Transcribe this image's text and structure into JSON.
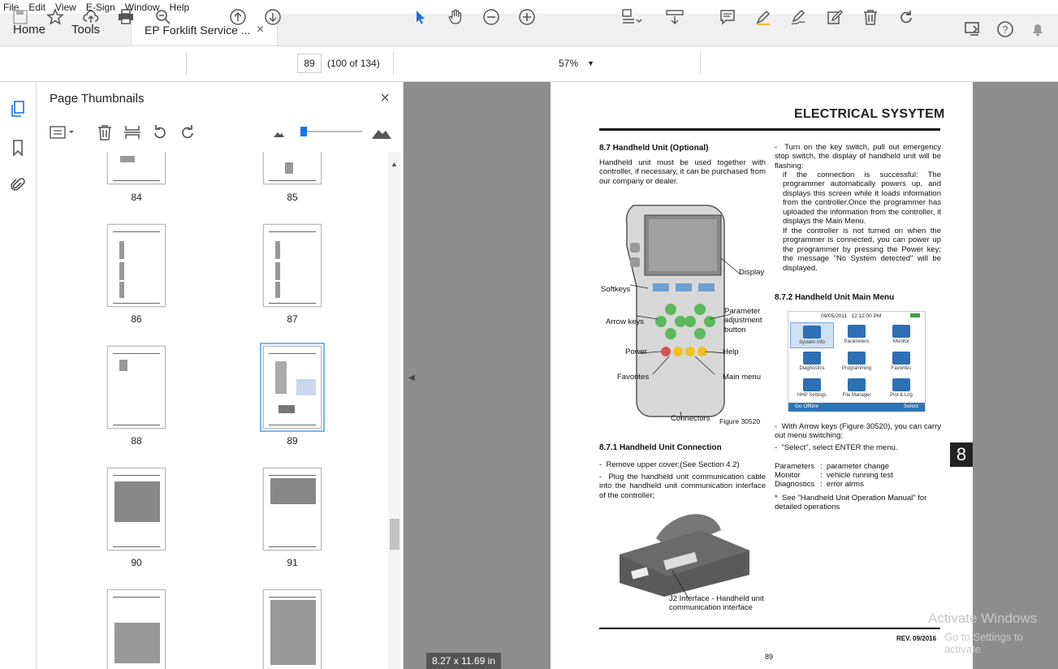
{
  "menu": [
    "File",
    "Edit",
    "View",
    "E-Sign",
    "Window",
    "Help"
  ],
  "tabs": {
    "home": "Home",
    "tools": "Tools",
    "document": "EP Forklift Service ...",
    "close": "×"
  },
  "toolbar": {
    "page_number": "89",
    "page_count": "(100 of 134)",
    "zoom": "57%"
  },
  "panel": {
    "title": "Page Thumbnails",
    "close": "×"
  },
  "thumbnails": [
    "84",
    "85",
    "86",
    "87",
    "88",
    "89",
    "90",
    "91"
  ],
  "page": {
    "header": "ELECTRICAL SYSYTEM",
    "s87_title": "8.7 Handheld Unit (Optional)",
    "s87_body": "Handheld unit must be used together with controller, if necessary, it can be purchased from our company or dealer.",
    "labels": {
      "display": "Display",
      "softkeys": "Softkeys",
      "arrow_keys": "Arrow keys",
      "parameter": "Parameter adjustment button",
      "power": "Power",
      "help": "Help",
      "favorites": "Favorites",
      "main_menu": "Main menu",
      "connectors": "Connectors",
      "figure": "Figure 30520"
    },
    "s871_title": "8.7.1 Handheld Unit Connection",
    "s871_items": [
      "Remove upper cover;(See Section 4.2)",
      "Plug the handheld unit communication cable into the handheld unit communication interface of the controller;"
    ],
    "j2_caption": "J2 Interface - Handheld unit communication interface",
    "right_intro": "Turn on the key switch, pull out emergency stop switch, the display of handheld unit will be flashing:",
    "right_success": "if the connection is successful: The programmer automatically powers up, and displays this screen while it loads information from the controller.Once the programmer has uploaded the information from the controller, it displays the Main Menu.",
    "right_notpowered": "If the controller is not turned on when the programmer is connected, you can power up the programmer by pressing the Power key; the message \"No System detected\" will be displayed.",
    "s872_title": "8.7.2 Handheld Unit Main Menu",
    "screen": {
      "date": "09/05/2011",
      "time": "12:12:00 PM",
      "icons": [
        "System Info",
        "Parameters",
        "Monitor",
        "Diagnostics",
        "Programming",
        "Favorites",
        "HHP Settings",
        "File Manager",
        "Plot & Log"
      ],
      "soft_left": "Go Offline",
      "soft_right": "Select"
    },
    "after_items": [
      "With Arrow keys (Figure 30520), you can carry out menu switching;",
      "\"Select\", select ENTER the menu."
    ],
    "defs": [
      [
        "Parameters",
        ":",
        "parameter change"
      ],
      [
        "Monitor",
        ":",
        "vehicle running test"
      ],
      [
        "Diagnostics",
        ":",
        "error alrms"
      ]
    ],
    "note": "See \"Handheld Unit Operation Manual\" for detailed operations",
    "rev": "REV. 09/2016",
    "page_no": "89",
    "chapter": "8"
  },
  "status": {
    "size": "8.27 x 11.69 in"
  },
  "watermark": {
    "line1": "Activate Windows",
    "line2": "Go to Settings to activate"
  }
}
